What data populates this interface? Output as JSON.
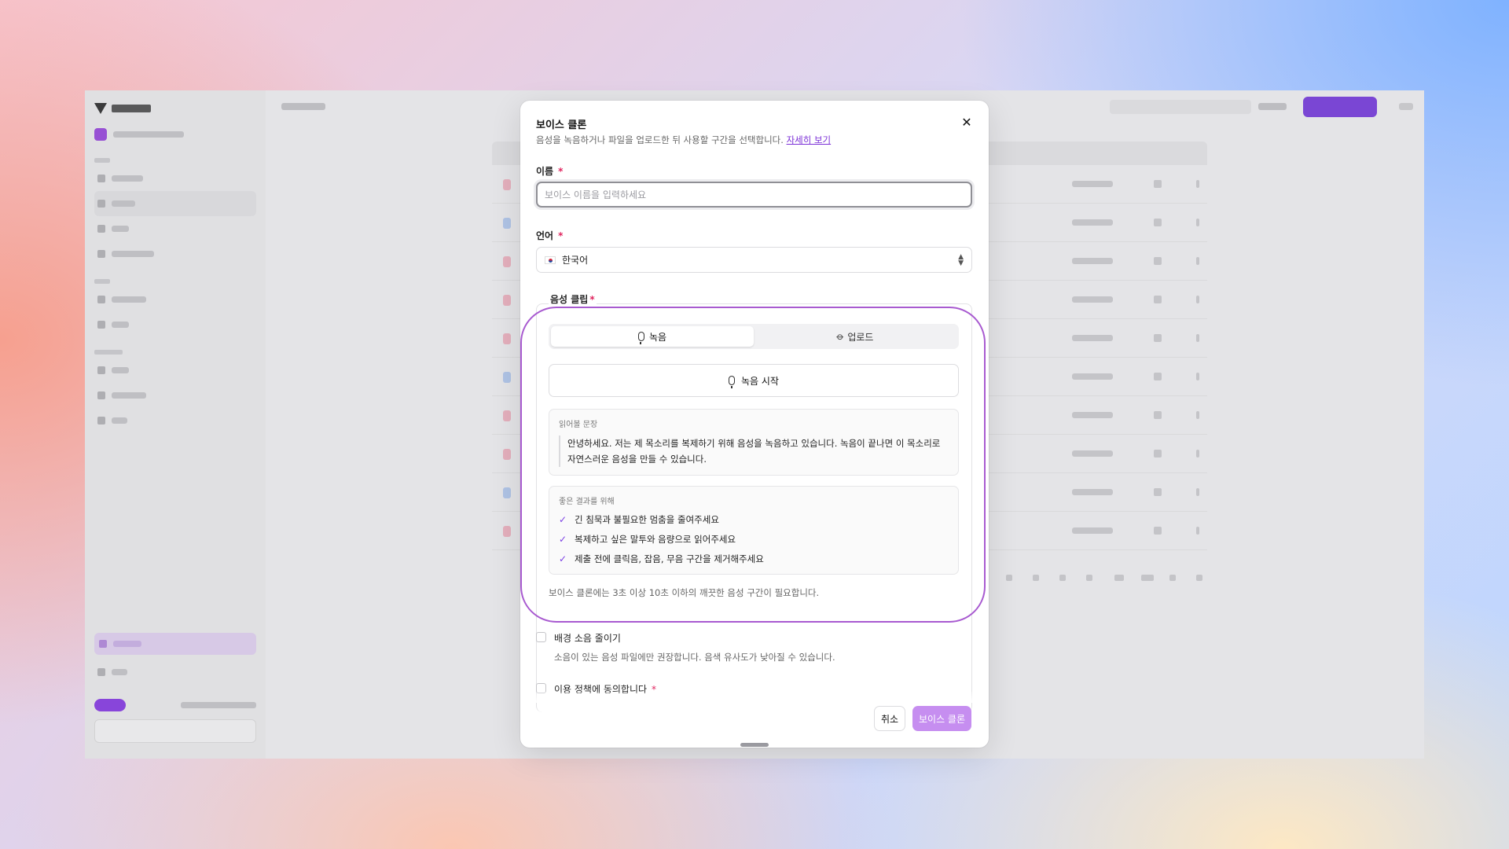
{
  "modal": {
    "title": "보이스 클론",
    "subtitle": "음성을 녹음하거나 파일을 업로드한 뒤 사용할 구간을 선택합니다.",
    "learn_more": "자세히 보기",
    "close_icon": "close-icon"
  },
  "form": {
    "name_label": "이름",
    "required_mark": "*",
    "name_placeholder": "보이스 이름을 입력하세요",
    "name_value": "",
    "language_label": "언어",
    "language_value": "한국어",
    "language_flag": "korea-flag-icon",
    "clip_label": "음성 클립"
  },
  "clip": {
    "tabs": [
      {
        "label": "녹음",
        "icon": "microphone-icon",
        "active": true
      },
      {
        "label": "업로드",
        "icon": "paperclip-icon",
        "active": false
      }
    ],
    "record_button": "녹음 시작",
    "script_heading": "읽어볼 문장",
    "script_text": "안녕하세요. 저는 제 목소리를 복제하기 위해 음성을 녹음하고 있습니다. 녹음이 끝나면 이 목소리로 자연스러운 음성을 만들 수 있습니다.",
    "tips_heading": "좋은 결과를 위해",
    "tips": [
      "긴 침묵과 불필요한 멈춤을 줄여주세요",
      "복제하고 싶은 말투와 음량으로 읽어주세요",
      "제출 전에 클릭음, 잡음, 무음 구간을 제거해주세요"
    ],
    "note": "보이스 클론에는 3초 이상 10초 이하의 깨끗한 음성 구간이 필요합니다."
  },
  "options": {
    "noise_label": "배경 소음 줄이기",
    "noise_desc": "소음이 있는 음성 파일에만 권장합니다. 음색 유사도가 낮아질 수 있습니다.",
    "noise_checked": false,
    "consent_label": "이용 정책에 동의합니다",
    "consent_checked": false
  },
  "footer": {
    "cancel": "취소",
    "submit": "보이스 클론"
  },
  "colors": {
    "accent": "#7b2fd6",
    "primary_disabled": "#c68ef0",
    "highlight_ring": "#a85ad0"
  }
}
